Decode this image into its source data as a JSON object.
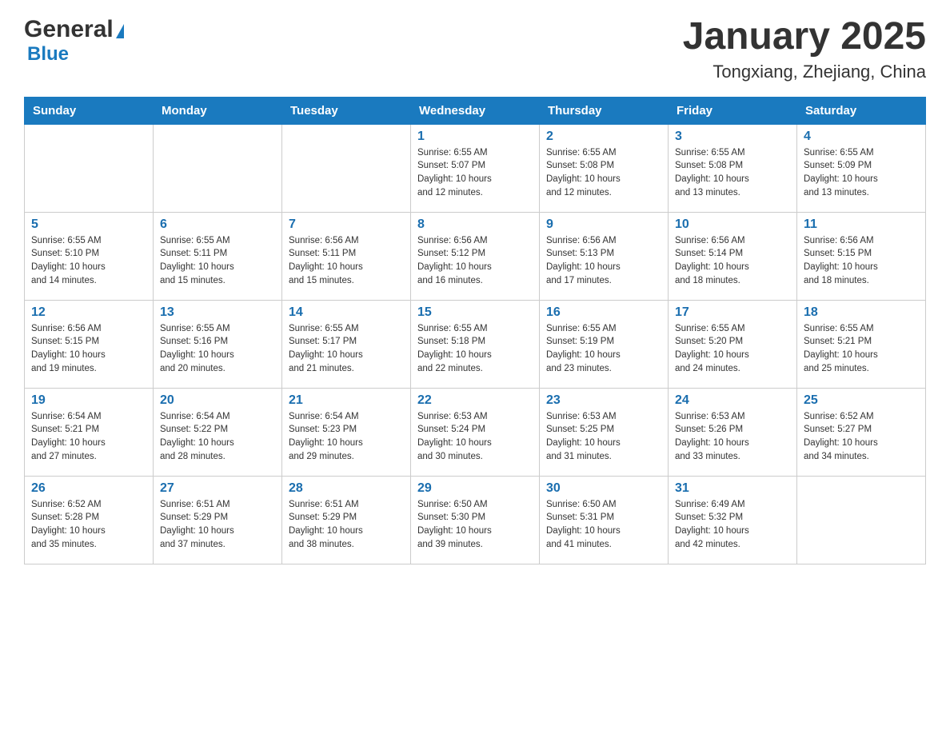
{
  "logo": {
    "general": "General",
    "blue": "Blue",
    "triangle": "▶"
  },
  "title": "January 2025",
  "location": "Tongxiang, Zhejiang, China",
  "days_of_week": [
    "Sunday",
    "Monday",
    "Tuesday",
    "Wednesday",
    "Thursday",
    "Friday",
    "Saturday"
  ],
  "weeks": [
    [
      {
        "day": "",
        "info": ""
      },
      {
        "day": "",
        "info": ""
      },
      {
        "day": "",
        "info": ""
      },
      {
        "day": "1",
        "info": "Sunrise: 6:55 AM\nSunset: 5:07 PM\nDaylight: 10 hours\nand 12 minutes."
      },
      {
        "day": "2",
        "info": "Sunrise: 6:55 AM\nSunset: 5:08 PM\nDaylight: 10 hours\nand 12 minutes."
      },
      {
        "day": "3",
        "info": "Sunrise: 6:55 AM\nSunset: 5:08 PM\nDaylight: 10 hours\nand 13 minutes."
      },
      {
        "day": "4",
        "info": "Sunrise: 6:55 AM\nSunset: 5:09 PM\nDaylight: 10 hours\nand 13 minutes."
      }
    ],
    [
      {
        "day": "5",
        "info": "Sunrise: 6:55 AM\nSunset: 5:10 PM\nDaylight: 10 hours\nand 14 minutes."
      },
      {
        "day": "6",
        "info": "Sunrise: 6:55 AM\nSunset: 5:11 PM\nDaylight: 10 hours\nand 15 minutes."
      },
      {
        "day": "7",
        "info": "Sunrise: 6:56 AM\nSunset: 5:11 PM\nDaylight: 10 hours\nand 15 minutes."
      },
      {
        "day": "8",
        "info": "Sunrise: 6:56 AM\nSunset: 5:12 PM\nDaylight: 10 hours\nand 16 minutes."
      },
      {
        "day": "9",
        "info": "Sunrise: 6:56 AM\nSunset: 5:13 PM\nDaylight: 10 hours\nand 17 minutes."
      },
      {
        "day": "10",
        "info": "Sunrise: 6:56 AM\nSunset: 5:14 PM\nDaylight: 10 hours\nand 18 minutes."
      },
      {
        "day": "11",
        "info": "Sunrise: 6:56 AM\nSunset: 5:15 PM\nDaylight: 10 hours\nand 18 minutes."
      }
    ],
    [
      {
        "day": "12",
        "info": "Sunrise: 6:56 AM\nSunset: 5:15 PM\nDaylight: 10 hours\nand 19 minutes."
      },
      {
        "day": "13",
        "info": "Sunrise: 6:55 AM\nSunset: 5:16 PM\nDaylight: 10 hours\nand 20 minutes."
      },
      {
        "day": "14",
        "info": "Sunrise: 6:55 AM\nSunset: 5:17 PM\nDaylight: 10 hours\nand 21 minutes."
      },
      {
        "day": "15",
        "info": "Sunrise: 6:55 AM\nSunset: 5:18 PM\nDaylight: 10 hours\nand 22 minutes."
      },
      {
        "day": "16",
        "info": "Sunrise: 6:55 AM\nSunset: 5:19 PM\nDaylight: 10 hours\nand 23 minutes."
      },
      {
        "day": "17",
        "info": "Sunrise: 6:55 AM\nSunset: 5:20 PM\nDaylight: 10 hours\nand 24 minutes."
      },
      {
        "day": "18",
        "info": "Sunrise: 6:55 AM\nSunset: 5:21 PM\nDaylight: 10 hours\nand 25 minutes."
      }
    ],
    [
      {
        "day": "19",
        "info": "Sunrise: 6:54 AM\nSunset: 5:21 PM\nDaylight: 10 hours\nand 27 minutes."
      },
      {
        "day": "20",
        "info": "Sunrise: 6:54 AM\nSunset: 5:22 PM\nDaylight: 10 hours\nand 28 minutes."
      },
      {
        "day": "21",
        "info": "Sunrise: 6:54 AM\nSunset: 5:23 PM\nDaylight: 10 hours\nand 29 minutes."
      },
      {
        "day": "22",
        "info": "Sunrise: 6:53 AM\nSunset: 5:24 PM\nDaylight: 10 hours\nand 30 minutes."
      },
      {
        "day": "23",
        "info": "Sunrise: 6:53 AM\nSunset: 5:25 PM\nDaylight: 10 hours\nand 31 minutes."
      },
      {
        "day": "24",
        "info": "Sunrise: 6:53 AM\nSunset: 5:26 PM\nDaylight: 10 hours\nand 33 minutes."
      },
      {
        "day": "25",
        "info": "Sunrise: 6:52 AM\nSunset: 5:27 PM\nDaylight: 10 hours\nand 34 minutes."
      }
    ],
    [
      {
        "day": "26",
        "info": "Sunrise: 6:52 AM\nSunset: 5:28 PM\nDaylight: 10 hours\nand 35 minutes."
      },
      {
        "day": "27",
        "info": "Sunrise: 6:51 AM\nSunset: 5:29 PM\nDaylight: 10 hours\nand 37 minutes."
      },
      {
        "day": "28",
        "info": "Sunrise: 6:51 AM\nSunset: 5:29 PM\nDaylight: 10 hours\nand 38 minutes."
      },
      {
        "day": "29",
        "info": "Sunrise: 6:50 AM\nSunset: 5:30 PM\nDaylight: 10 hours\nand 39 minutes."
      },
      {
        "day": "30",
        "info": "Sunrise: 6:50 AM\nSunset: 5:31 PM\nDaylight: 10 hours\nand 41 minutes."
      },
      {
        "day": "31",
        "info": "Sunrise: 6:49 AM\nSunset: 5:32 PM\nDaylight: 10 hours\nand 42 minutes."
      },
      {
        "day": "",
        "info": ""
      }
    ]
  ]
}
